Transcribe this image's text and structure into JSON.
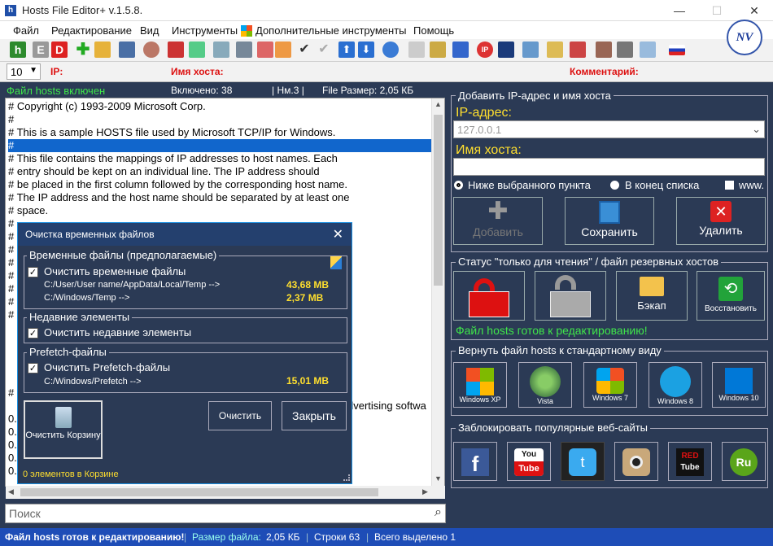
{
  "window": {
    "title": "Hosts File Editor+ v.1.5.8."
  },
  "menu": [
    "Файл",
    "Редактирование",
    "Вид",
    "Инструменты",
    "Дополнительные инструменты",
    "Помощь"
  ],
  "fieldbar": {
    "count_value": "10",
    "ip_label": "IP:",
    "host_label": "Имя хоста:",
    "comment_label": "Комментарий:"
  },
  "status_top": {
    "hosts_state": "Файл hosts включен",
    "enabled": "Включено: 38",
    "nm": "| Нм.3 |",
    "file_size": "File Размер: 2,05 КБ"
  },
  "editor_lines": [
    "# Copyright (c) 1993-2009 Microsoft Corp.",
    "#",
    "# This is a sample HOSTS file used by Microsoft TCP/IP for Windows.",
    "#",
    "# This file contains the mappings of IP addresses to host names. Each",
    "# entry should be kept on an individual line. The IP address should",
    "# be placed in the first column followed by the corresponding host name.",
    "# The IP address and the host name should be separated by at least one",
    "# space.",
    "#"
  ],
  "editor_partial": {
    "hash": "#",
    "advertising": "dvertising softwa",
    "zero": "0."
  },
  "search": {
    "placeholder": "Поиск"
  },
  "add_panel": {
    "title": "Добавить IP-адрес и имя хоста",
    "ip_label": "IP-адрес:",
    "ip_value": "127.0.0.1",
    "host_label": "Имя хоста:",
    "radio_below": "Ниже выбранного пункта",
    "radio_end": "В конец списка",
    "www": "www.",
    "add": "Добавить",
    "save": "Сохранить",
    "delete": "Удалить"
  },
  "status_panel": {
    "title": "Статус \"только для чтения\" / файл резервных хостов",
    "backup": "Бэкап",
    "restore": "Восстановить",
    "ready": "Файл hosts готов к редактированию!"
  },
  "restore_panel": {
    "title": "Вернуть файл hosts к стандартному виду",
    "labels": [
      "Windows XP",
      "Vista",
      "Windows 7",
      "Windows 8",
      "Windows 10"
    ]
  },
  "block_panel": {
    "title": "Заблокировать популярные веб-сайты"
  },
  "dialog": {
    "title": "Очистка временных файлов",
    "temp_group": "Временные файлы (предполагаемые)",
    "temp_check": "Очистить временные файлы",
    "temp_path1": "C:/User/User name/AppData/Local/Temp -->",
    "temp_size1": "43,68 MB",
    "temp_path2": "C:/Windows/Temp -->",
    "temp_size2": "2,37 MB",
    "recent_group": "Недавние элементы",
    "recent_check": "Очистить недавние элементы",
    "prefetch_group": "Prefetch-файлы",
    "prefetch_check": "Очистить Prefetch-файлы",
    "prefetch_path": "C:/Windows/Prefetch -->",
    "prefetch_size": "15,01 MB",
    "recycle_label": "Очистить Корзину",
    "clean": "Очистить",
    "close": "Закрыть",
    "footer": "0 элементов в Корзине"
  },
  "bottom_status": {
    "ready": "Файл hosts готов к редактированию!",
    "size_label": "Размер файла:",
    "size_value": "2,05 КБ",
    "lines": "Строки 63",
    "selected": "Всего выделено 1"
  },
  "colors": {
    "bg": "#2b3a55",
    "accent_yellow": "#ffdf2e",
    "accent_green": "#3fe54a",
    "status_blue": "#1e4db7",
    "selection": "#1166cc"
  }
}
